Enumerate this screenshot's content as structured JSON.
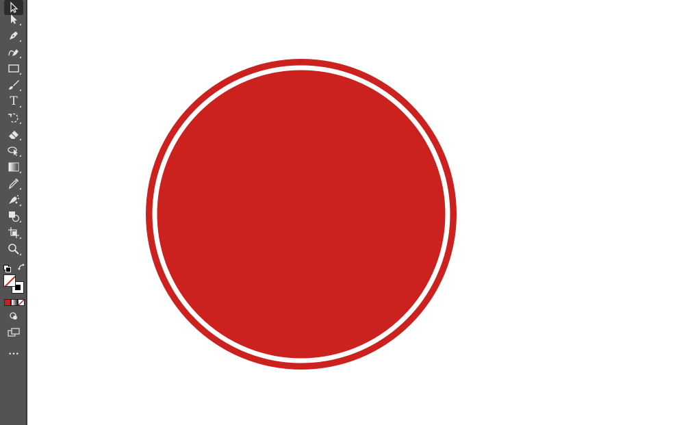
{
  "toolbar": {
    "background": "#535353",
    "icon_color": "#e6e6e6",
    "active_background": "#2c2c2c",
    "tools": [
      {
        "id": "selection",
        "icon": "selection-arrow-icon",
        "active": true
      },
      {
        "id": "direct-selection",
        "icon": "direct-selection-arrow-icon",
        "active": false
      },
      {
        "id": "pen",
        "icon": "pen-icon",
        "active": false
      },
      {
        "id": "curvature",
        "icon": "curvature-pen-icon",
        "active": false
      },
      {
        "id": "rectangle",
        "icon": "rectangle-icon",
        "active": false
      },
      {
        "id": "paintbrush",
        "icon": "paintbrush-icon",
        "active": false
      },
      {
        "id": "type",
        "icon": "type-icon",
        "active": false
      },
      {
        "id": "rotate",
        "icon": "rotate-icon",
        "active": false
      },
      {
        "id": "eraser",
        "icon": "eraser-icon",
        "active": false
      },
      {
        "id": "puppet-warp",
        "icon": "puppet-warp-icon",
        "active": false
      },
      {
        "id": "gradient",
        "icon": "gradient-icon",
        "active": false
      },
      {
        "id": "eyedropper",
        "icon": "eyedropper-icon",
        "active": false
      },
      {
        "id": "symbol-sprayer",
        "icon": "symbol-sprayer-icon",
        "active": false
      },
      {
        "id": "shape-builder",
        "icon": "shape-builder-icon",
        "active": false
      },
      {
        "id": "artboard",
        "icon": "artboard-icon",
        "active": false
      },
      {
        "id": "zoom",
        "icon": "zoom-icon",
        "active": false
      }
    ],
    "type_tool_glyph": "T",
    "more_tools_glyph": "•••",
    "fill": {
      "value": "none",
      "none_indicator_color": "#d21f1f"
    },
    "stroke": {
      "value": "black"
    },
    "color_modes": [
      "color",
      "gradient",
      "none"
    ]
  },
  "canvas": {
    "background": "#ffffff",
    "artwork": {
      "shape": "circle",
      "fill_color": "#cc221f",
      "ring_color": "#ffffff"
    }
  }
}
